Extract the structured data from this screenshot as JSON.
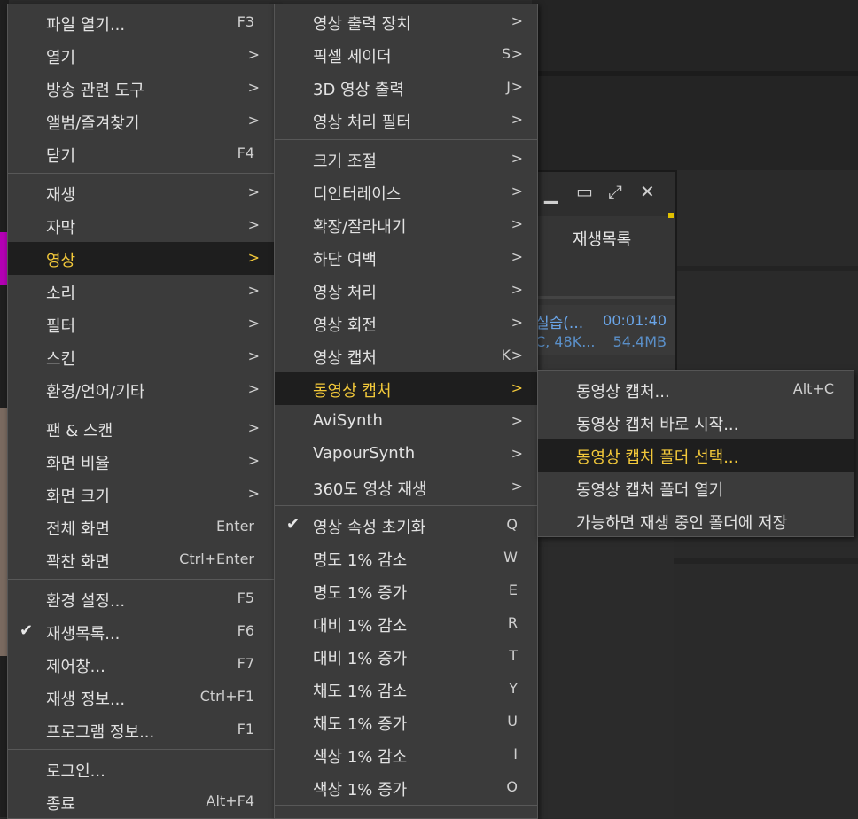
{
  "player": {
    "playlist_tab": "재생목록",
    "entry": {
      "title": "실습(...",
      "duration": "00:01:40",
      "meta": "C, 48K...",
      "size": "54.4MB"
    },
    "window_buttons": [
      "minimize-icon",
      "maximize-icon",
      "fullscreen-icon",
      "close-icon"
    ]
  },
  "main_menu": {
    "items": [
      {
        "label": "파일 열기...",
        "shortcut": "F3"
      },
      {
        "label": "열기",
        "arrow": ">"
      },
      {
        "label": "방송 관련 도구",
        "arrow": ">"
      },
      {
        "label": "앨범/즐겨찾기",
        "arrow": ">"
      },
      {
        "label": "닫기",
        "shortcut": "F4"
      },
      {
        "label": "재생",
        "arrow": ">"
      },
      {
        "label": "자막",
        "arrow": ">"
      },
      {
        "label": "영상",
        "arrow": ">",
        "active": true
      },
      {
        "label": "소리",
        "arrow": ">"
      },
      {
        "label": "필터",
        "arrow": ">"
      },
      {
        "label": "스킨",
        "arrow": ">"
      },
      {
        "label": "환경/언어/기타",
        "arrow": ">"
      },
      {
        "label": "팬 & 스캔",
        "arrow": ">"
      },
      {
        "label": "화면 비율",
        "arrow": ">"
      },
      {
        "label": "화면 크기",
        "arrow": ">"
      },
      {
        "label": "전체 화면",
        "shortcut": "Enter"
      },
      {
        "label": "꽉찬 화면",
        "shortcut": "Ctrl+Enter"
      },
      {
        "label": "환경 설정...",
        "shortcut": "F5"
      },
      {
        "label": "재생목록...",
        "shortcut": "F6",
        "checked": true
      },
      {
        "label": "제어창...",
        "shortcut": "F7"
      },
      {
        "label": "재생 정보...",
        "shortcut": "Ctrl+F1"
      },
      {
        "label": "프로그램 정보...",
        "shortcut": "F1"
      },
      {
        "label": "로그인..."
      },
      {
        "label": "종료",
        "shortcut": "Alt+F4"
      }
    ]
  },
  "video_menu": {
    "items": [
      {
        "label": "영상 출력 장치",
        "arrow": ">"
      },
      {
        "label": "픽셀 세이더",
        "shortcut": "S",
        "arrow": ">"
      },
      {
        "label": "3D 영상 출력",
        "shortcut": "J",
        "arrow": ">"
      },
      {
        "label": "영상 처리 필터",
        "arrow": ">"
      },
      {
        "label": "크기 조절",
        "arrow": ">"
      },
      {
        "label": "디인터레이스",
        "arrow": ">"
      },
      {
        "label": "확장/잘라내기",
        "arrow": ">"
      },
      {
        "label": "하단 여백",
        "arrow": ">"
      },
      {
        "label": "영상 처리",
        "arrow": ">"
      },
      {
        "label": "영상 회전",
        "arrow": ">"
      },
      {
        "label": "영상 캡처",
        "shortcut": "K",
        "arrow": ">"
      },
      {
        "label": "동영상 캡처",
        "arrow": ">",
        "active": true
      },
      {
        "label": "AviSynth",
        "arrow": ">"
      },
      {
        "label": "VapourSynth",
        "arrow": ">"
      },
      {
        "label": "360도 영상 재생",
        "arrow": ">"
      },
      {
        "label": "영상 속성 초기화",
        "shortcut": "Q",
        "checked": true
      },
      {
        "label": "명도 1% 감소",
        "shortcut": "W"
      },
      {
        "label": "명도 1% 증가",
        "shortcut": "E"
      },
      {
        "label": "대비 1% 감소",
        "shortcut": "R"
      },
      {
        "label": "대비 1% 증가",
        "shortcut": "T"
      },
      {
        "label": "채도 1% 감소",
        "shortcut": "Y"
      },
      {
        "label": "채도 1% 증가",
        "shortcut": "U"
      },
      {
        "label": "색상 1% 감소",
        "shortcut": "I"
      },
      {
        "label": "색상 1% 증가",
        "shortcut": "O"
      }
    ]
  },
  "capture_menu": {
    "items": [
      {
        "label": "동영상 캡처...",
        "shortcut": "Alt+C"
      },
      {
        "label": "동영상 캡처 바로 시작..."
      },
      {
        "label": "동영상 캡처 폴더 선택...",
        "active": true
      },
      {
        "label": "동영상 캡처 폴더 열기"
      },
      {
        "label": "가능하면 재생 중인 폴더에 저장"
      }
    ]
  },
  "colors": {
    "active_text": "#f2c83a",
    "menu_bg": "#3b3b3b",
    "active_bg": "#1e1e1e",
    "link_blue": "#6aa5e8"
  }
}
